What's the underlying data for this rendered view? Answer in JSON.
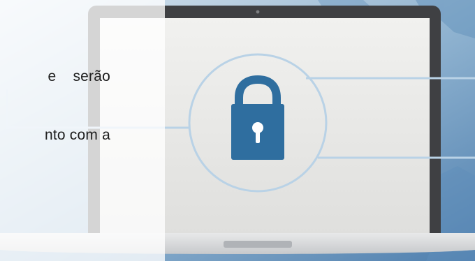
{
  "overlay": {
    "lines": [
      "e    serão",
      "nto com a"
    ]
  },
  "colors": {
    "background_blue": "#4f7fae",
    "screen_gray": "#e8e8e6",
    "laptop_dark": "#3f4043",
    "lock_blue": "#2f6e9f",
    "circuit_blue": "#b9d2e6"
  },
  "icons": {
    "lock": "lock-icon",
    "camera": "camera-dot-icon"
  }
}
